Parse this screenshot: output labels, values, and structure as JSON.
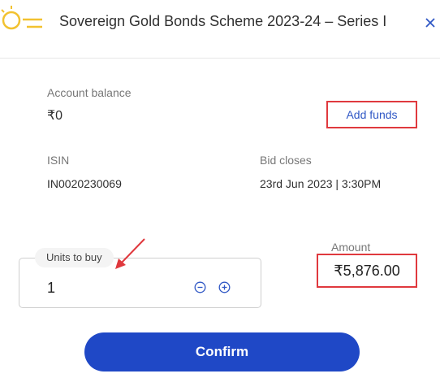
{
  "header": {
    "title": "Sovereign Gold Bonds Scheme 2023-24 – Series I",
    "logo_icon": "coin-sun-icon",
    "close_icon": "close-icon"
  },
  "account": {
    "balance_label": "Account balance",
    "balance_value": "₹0",
    "add_funds_label": "Add funds"
  },
  "details": {
    "isin_label": "ISIN",
    "isin_value": "IN0020230069",
    "bid_closes_label": "Bid closes",
    "bid_closes_value": "23rd Jun 2023 | 3:30PM"
  },
  "order": {
    "units_label": "Units to buy",
    "units_value": "1",
    "amount_label": "Amount",
    "amount_value": "₹5,876.00"
  },
  "actions": {
    "confirm_label": "Confirm"
  },
  "colors": {
    "accent": "#1f48c6",
    "link": "#2f57c5",
    "highlight": "#e0393e",
    "logo": "#f2c230"
  }
}
